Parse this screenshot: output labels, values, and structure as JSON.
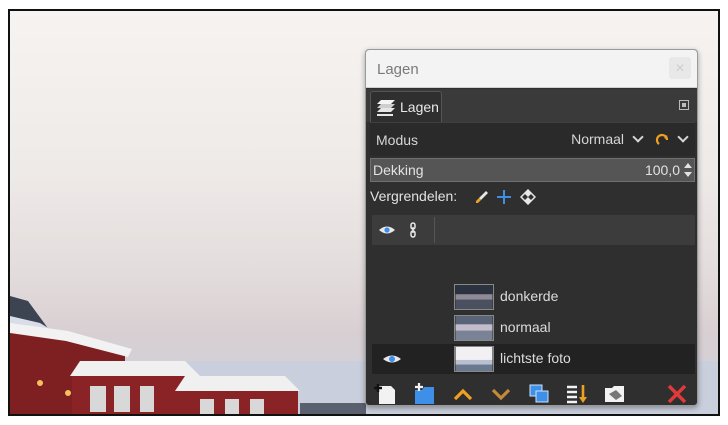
{
  "dialog": {
    "title": "Lagen"
  },
  "tab": {
    "label": "Lagen"
  },
  "mode": {
    "label": "Modus",
    "value": "Normaal"
  },
  "opacity": {
    "label": "Dekking",
    "value": "100,0"
  },
  "lock": {
    "label": "Vergrendelen:"
  },
  "layers": [
    {
      "name": "donkerde",
      "visible": false,
      "selected": false
    },
    {
      "name": "normaal",
      "visible": false,
      "selected": false
    },
    {
      "name": "lichtste foto",
      "visible": true,
      "selected": true
    }
  ],
  "icons": {
    "close": "close-icon",
    "tab": "layers-stack-icon",
    "tab_menu": "tab-menu-icon",
    "composite": "composite-mode-icon",
    "lock_paint": "brush-icon",
    "lock_position": "move-cross-icon",
    "lock_alpha": "checkerboard-icon",
    "header_visibility": "eye-icon",
    "header_link": "chain-icon",
    "toolbar": [
      "new-layer-icon",
      "new-layer-group-icon",
      "raise-layer-icon",
      "lower-layer-icon",
      "duplicate-layer-icon",
      "merge-down-icon",
      "layer-mask-icon",
      "delete-layer-icon"
    ]
  },
  "colors": {
    "dock_bg": "#2f2f2f",
    "accent_orange": "#f0a020",
    "accent_blue": "#3d8fe8",
    "delete_red": "#e23a3a"
  }
}
